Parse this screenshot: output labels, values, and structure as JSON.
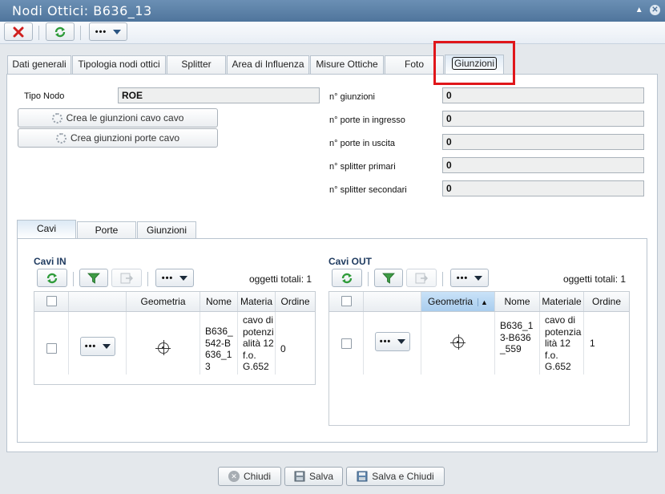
{
  "window": {
    "title": "Nodi Ottici: B636_13"
  },
  "toolbar": {
    "more_label": "•••"
  },
  "tabs": [
    {
      "label": "Dati generali"
    },
    {
      "label": "Tipologia nodi ottici"
    },
    {
      "label": "Splitter"
    },
    {
      "label": "Area di Influenza"
    },
    {
      "label": "Misure Ottiche"
    },
    {
      "label": "Foto"
    },
    {
      "label": "Giunzioni"
    }
  ],
  "form": {
    "tipo_nodo_label": "Tipo Nodo",
    "tipo_nodo_value": "ROE",
    "btn_cavo_cavo": "Crea le giunzioni cavo cavo",
    "btn_porte_cavo": "Crea giunzioni porte cavo",
    "fields": [
      {
        "label": "n° giunzioni",
        "value": "0"
      },
      {
        "label": "n° porte in ingresso",
        "value": "0"
      },
      {
        "label": "n° porte in uscita",
        "value": "0"
      },
      {
        "label": "n° splitter primari",
        "value": "0"
      },
      {
        "label": "n° splitter secondari",
        "value": "0"
      }
    ]
  },
  "inner_tabs": [
    {
      "label": "Cavi"
    },
    {
      "label": "Porte"
    },
    {
      "label": "Giunzioni"
    }
  ],
  "cavi_in": {
    "title": "Cavi IN",
    "more_label": "•••",
    "total": "oggetti totali: 1",
    "columns": [
      "Geometria",
      "Nome",
      "Materia",
      "Ordine"
    ],
    "row": {
      "nome": "B636_542-B636_13",
      "materiale": "cavo di potenzialità 12 f.o. G.652",
      "ordine": "0",
      "menu": "•••"
    }
  },
  "cavi_out": {
    "title": "Cavi OUT",
    "more_label": "•••",
    "total": "oggetti totali: 1",
    "columns": [
      "Geometria",
      "Nome",
      "Materiale",
      "Ordine"
    ],
    "row": {
      "nome": "B636_13-B636_559",
      "materiale": "cavo di potenzialità 12 f.o. G.652",
      "ordine": "1",
      "menu": "•••"
    }
  },
  "footer": {
    "chiudi": "Chiudi",
    "salva": "Salva",
    "salva_chiudi": "Salva e Chiudi"
  },
  "colors": {
    "title_bar": "#5a80a8",
    "highlight": "#e0161a",
    "accent_green": "#2f9b3a"
  }
}
